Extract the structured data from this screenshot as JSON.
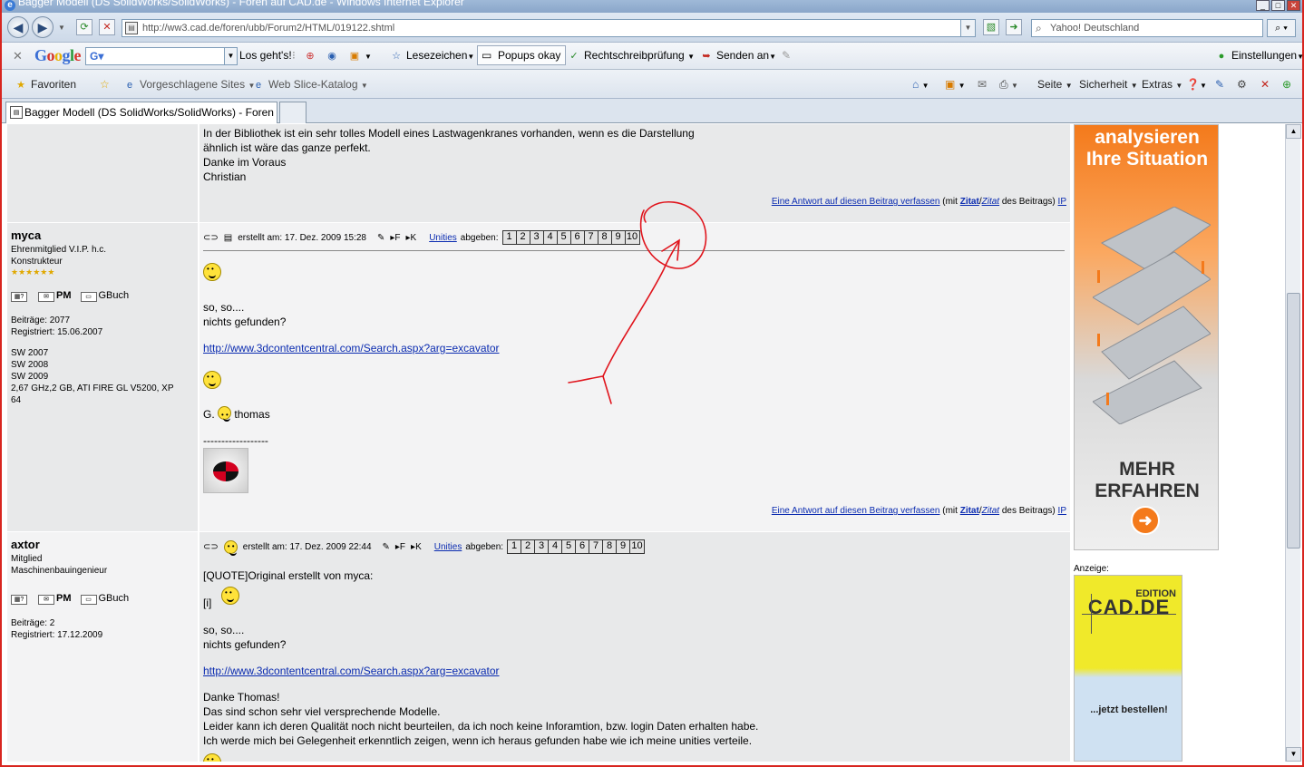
{
  "window": {
    "title": "Bagger Modell (DS SolidWorks/SolidWorks) - Foren auf CAD.de - Windows Internet Explorer"
  },
  "address": {
    "url": "http://ww3.cad.de/foren/ubb/Forum2/HTML/019122.shtml",
    "search_placeholder": "Yahoo! Deutschland"
  },
  "google_toolbar": {
    "logo": "Google",
    "search_value": "G",
    "go_label": "Los geht's!",
    "bookmarks_label": "Lesezeichen",
    "popups_label": "Popups okay",
    "spell_label": "Rechtschreibprüfung",
    "send_label": "Senden an",
    "settings_label": "Einstellungen"
  },
  "favorites_bar": {
    "favorites_label": "Favoriten",
    "suggested_label": "Vorgeschlagene Sites",
    "webslice_label": "Web Slice-Katalog",
    "page_label": "Seite",
    "security_label": "Sicherheit",
    "extras_label": "Extras"
  },
  "tab": {
    "label": "Bagger Modell (DS SolidWorks/SolidWorks) - Foren auf..."
  },
  "post0": {
    "lines": [
      "In der Bibliothek ist ein sehr tolles Modell eines Lastwagenkranes vorhanden, wenn es die Darstellung",
      "ähnlich ist wäre das ganze perfekt.",
      "Danke im Voraus",
      "Christian"
    ]
  },
  "reply": {
    "link": "Eine Antwort auf diesen Beitrag verfassen",
    "mit": "(mit",
    "zitat1": "Zitat",
    "zitat2": "Zitat",
    "des": "des Beitrags)",
    "ip": "IP"
  },
  "meta": {
    "unities_label": "Unities",
    "abgeben_label": "abgeben:",
    "ratings": [
      "1",
      "2",
      "3",
      "4",
      "5",
      "6",
      "7",
      "8",
      "9",
      "10"
    ]
  },
  "post1": {
    "user": "myca",
    "rank": "Ehrenmitglied V.I.P. h.c.",
    "role": "Konstrukteur",
    "stars": "★★★★★★",
    "pm": "PM",
    "gbuch": "GBuch",
    "posts": "Beiträge: 2077",
    "registered": "Registriert: 15.06.2007",
    "sig": [
      "SW 2007",
      "SW 2008",
      "SW 2009",
      "2,67 GHz,2 GB, ATI FIRE GL V5200, XP",
      "64"
    ],
    "date": "erstellt am: 17. Dez. 2009 15:28",
    "line1": "so, so....",
    "line2": "nichts gefunden?",
    "link": "http://www.3dcontentcentral.com/Search.aspx?arg=excavator",
    "greet_g": "G.",
    "greet_name": "thomas",
    "dashes": "------------------"
  },
  "post2": {
    "user": "axtor",
    "rank": "Mitglied",
    "role": "Maschinenbauingenieur",
    "pm": "PM",
    "gbuch": "GBuch",
    "posts": "Beiträge: 2",
    "registered": "Registriert: 17.12.2009",
    "date": "erstellt am: 17. Dez. 2009 22:44",
    "quote": "[QUOTE]Original erstellt von myca:",
    "i": "[i]",
    "line1": "so, so....",
    "line2": "nichts gefunden?",
    "link": "http://www.3dcontentcentral.com/Search.aspx?arg=excavator",
    "thanks": "Danke Thomas!",
    "p1": "Das sind schon sehr viel versprechende Modelle.",
    "p2": "Leider kann ich deren Qualität noch nicht beurteilen, da ich noch keine Inforamtion, bzw. login Daten erhalten habe.",
    "p3": "Ich werde mich bei Gelegenheit erkenntlich zeigen, wenn ich heraus gefunden habe wie ich meine unities verteile."
  },
  "ads": {
    "ad1_line1": "analysieren",
    "ad1_line2": "Ihre Situation",
    "ad1_line3": "MEHR",
    "ad1_line4": "ERFAHREN",
    "anzeige": "Anzeige:",
    "ad2_edition": "EDITION",
    "ad2_brand": "CAD.DE",
    "ad2_cta": "...jetzt bestellen!"
  },
  "annotation": {
    "color": "#e0141c"
  }
}
